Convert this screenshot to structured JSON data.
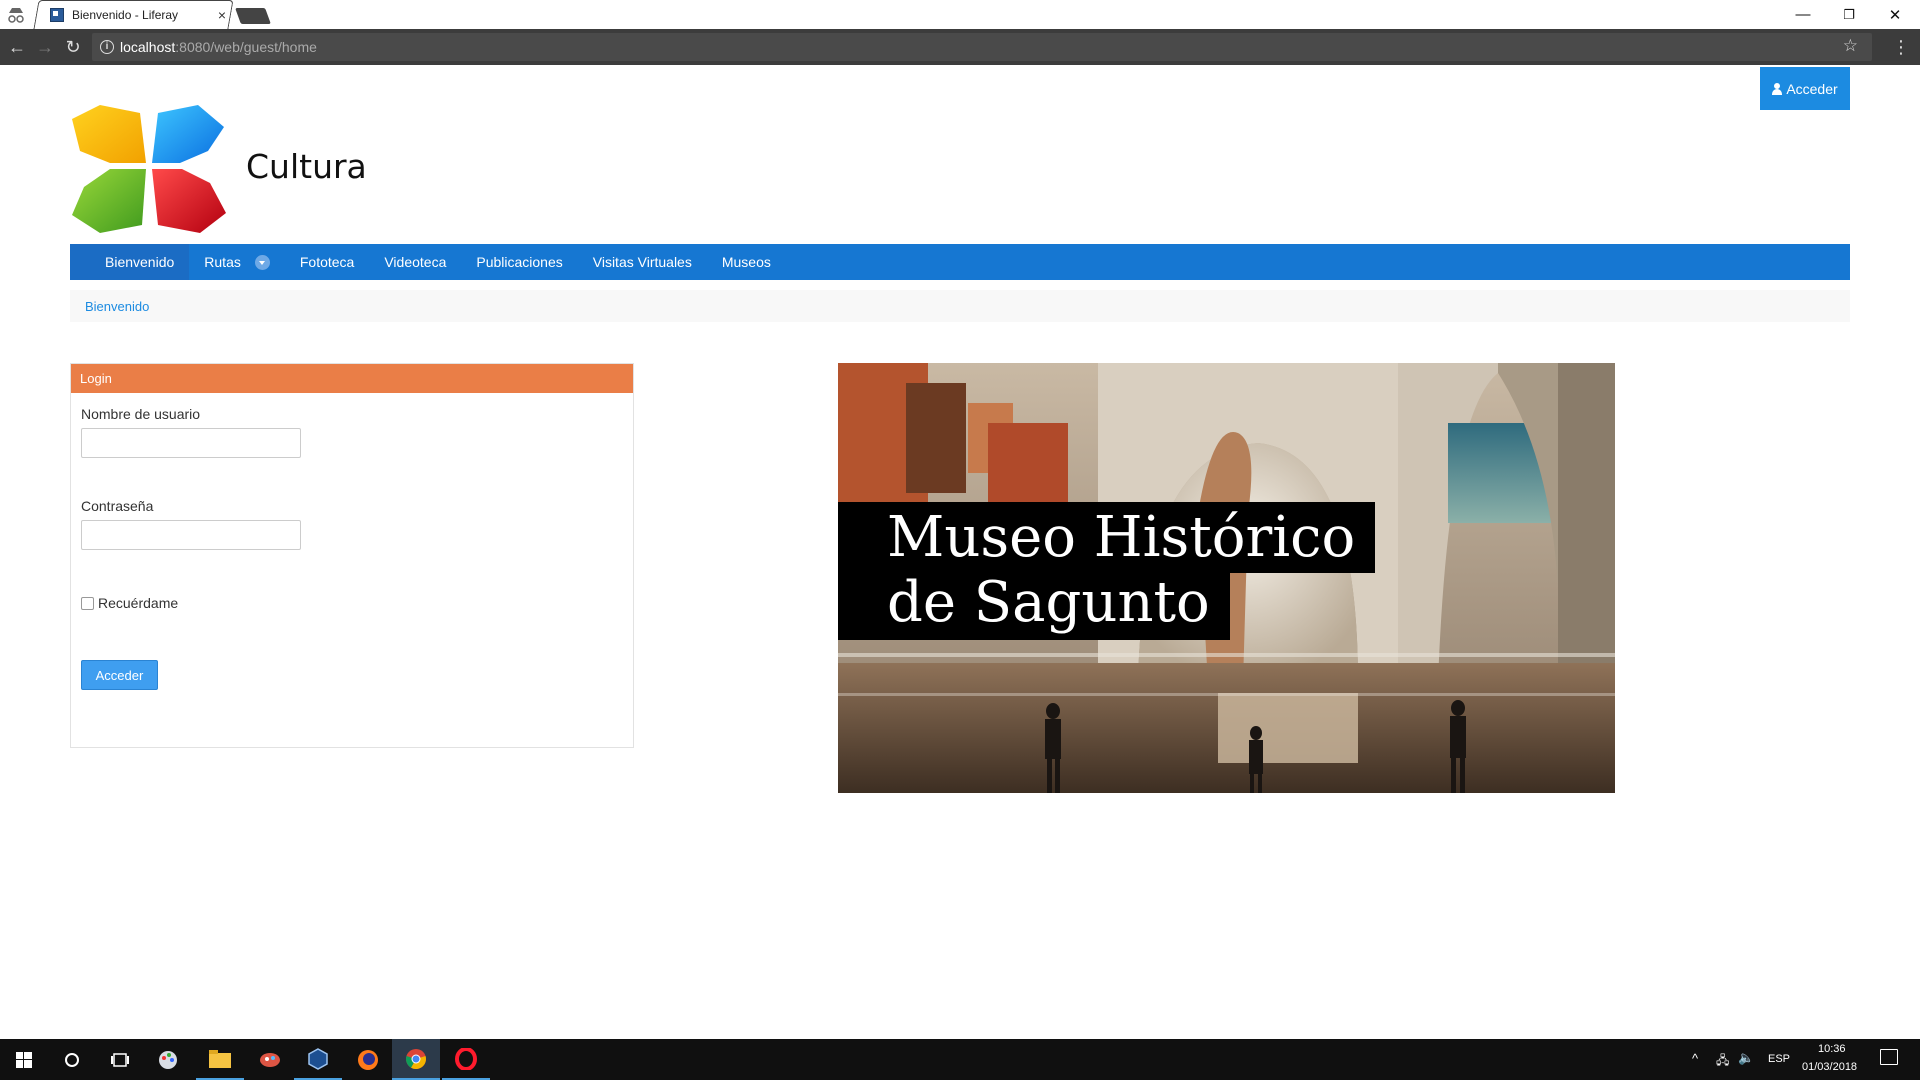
{
  "browser": {
    "tab_title": "Bienvenido - Liferay",
    "tab_close": "×",
    "url_host": "localhost",
    "url_rest": ":8080/web/guest/home",
    "window_controls": {
      "minimize": "—",
      "restore": "❐",
      "close": "✕"
    }
  },
  "page": {
    "sign_in_label": "Acceder",
    "site_name": "Cultura",
    "nav": {
      "items": [
        {
          "label": "Bienvenido"
        },
        {
          "label": "Rutas"
        },
        {
          "label": "Fototeca"
        },
        {
          "label": "Videoteca"
        },
        {
          "label": "Publicaciones"
        },
        {
          "label": "Visitas Virtuales"
        },
        {
          "label": "Museos"
        }
      ]
    },
    "breadcrumb": "Bienvenido",
    "login": {
      "title": "Login",
      "username_label": "Nombre de usuario",
      "username_value": "",
      "password_label": "Contraseña",
      "password_value": "",
      "remember_label": "Recuérdame",
      "remember_checked": false,
      "submit_label": "Acceder"
    },
    "banner": {
      "line1": "Museo Histórico",
      "line2": "de Sagunto"
    }
  },
  "taskbar": {
    "language": "ESP",
    "time": "10:36",
    "date": "01/03/2018",
    "pinned_icons": [
      "windows-start",
      "cortana-search",
      "task-view",
      "paint",
      "file-explorer",
      "paint-3d",
      "virtualbox",
      "firefox",
      "chrome",
      "opera"
    ]
  },
  "colors": {
    "nav_blue": "#1677d2",
    "accent_blue": "#1c8be1",
    "portlet_orange": "#ea7e47"
  }
}
